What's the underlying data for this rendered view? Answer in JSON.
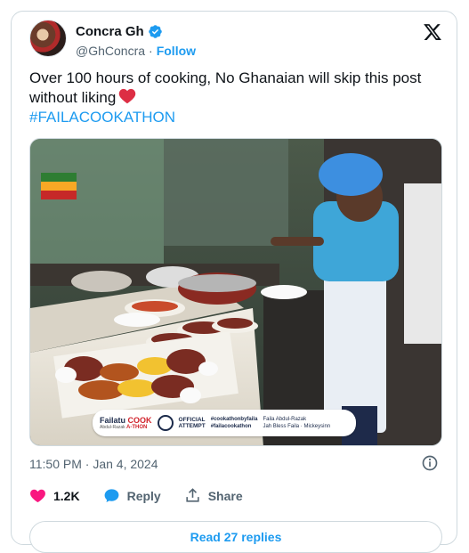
{
  "author": {
    "name": "Concra Gh",
    "handle": "@GhConcra",
    "separator": "·",
    "follow_label": "Follow"
  },
  "tweet": {
    "text": "Over 100 hours of cooking, No Ghanaian will skip this post without liking",
    "emoji": "red-heart-icon",
    "hashtag": "#FAILACOOKATHON"
  },
  "media": {
    "banner": {
      "brand_a": "Failatu",
      "brand_b": "COOK",
      "brand_c": "A-THON",
      "brand_sub": "Abdul-Razak",
      "badge": "GUINNESS",
      "official": "OFFICIAL",
      "attempt": "ATTEMPT",
      "tag1": "#cookathonbyfaila",
      "tag2": "#failacookathon",
      "handle1": "Faila Abdul-Razak",
      "handle2": "Jah Bless Faila",
      "handle3": "Mickeysinn"
    },
    "colors": {
      "apron": "#e9eef4",
      "shirt": "#3ea6d8",
      "cap": "#3d8fe0"
    }
  },
  "meta": {
    "timestamp": "11:50 PM · Jan 4, 2024"
  },
  "actions": {
    "like_count": "1.2K",
    "reply_label": "Reply",
    "share_label": "Share"
  },
  "replies_button": "Read 27 replies",
  "colors": {
    "accent": "#1d9bf0",
    "like": "#f91880",
    "muted": "#536471"
  }
}
